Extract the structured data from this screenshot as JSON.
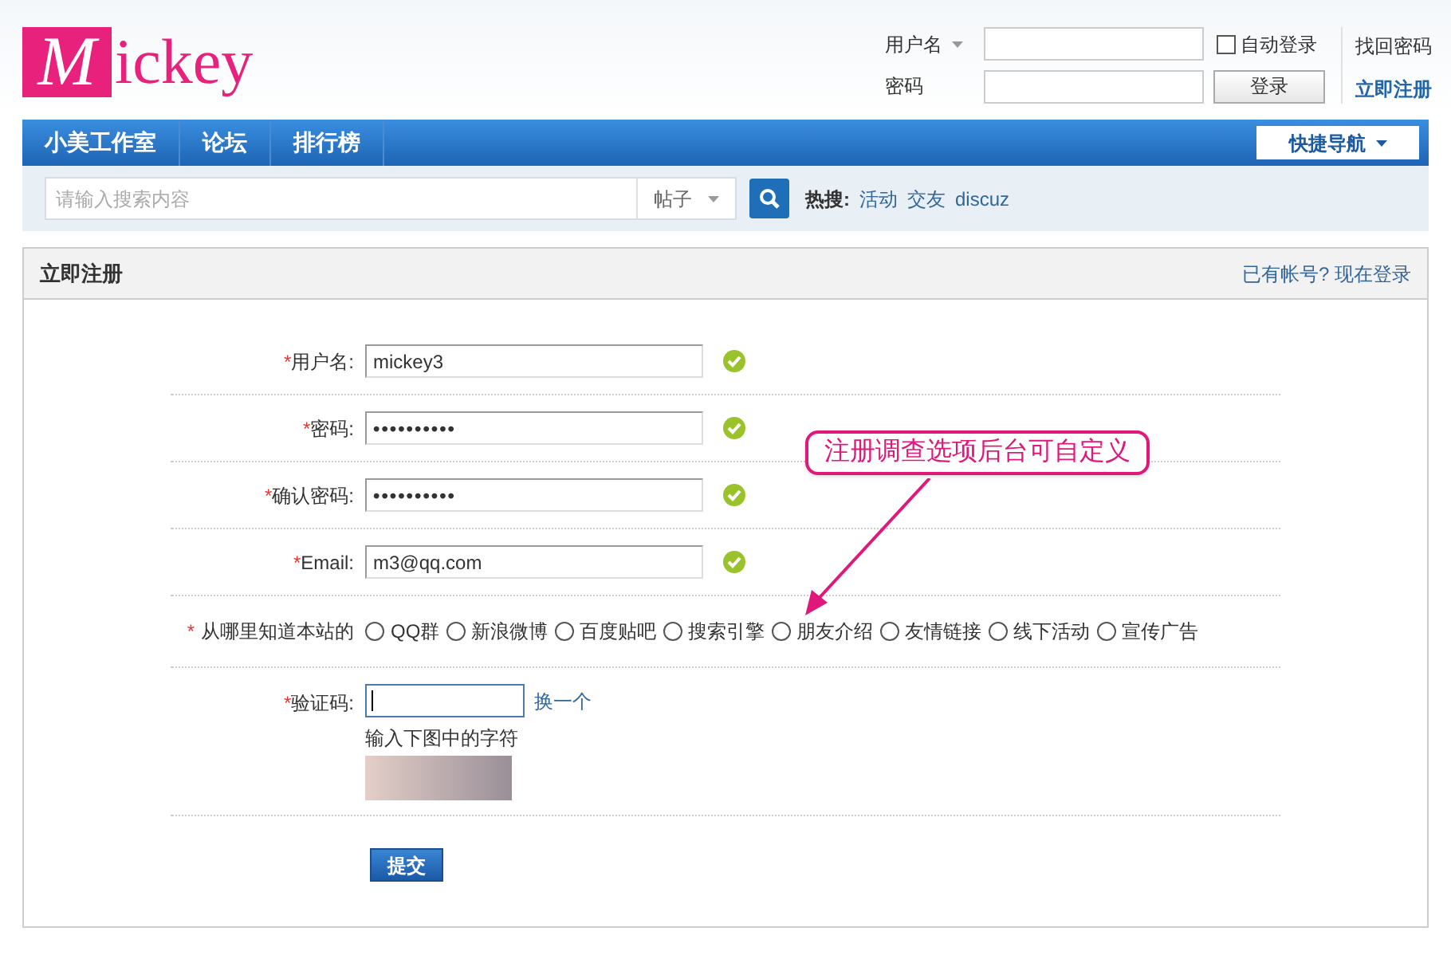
{
  "logo": {
    "initial": "M",
    "rest": "ickey"
  },
  "login": {
    "username_label": "用户名",
    "password_label": "密码",
    "auto_login": {
      "label": "自动登录",
      "checked": false
    },
    "login_button": "登录",
    "forgot_link": "找回密码",
    "register_link": "立即注册"
  },
  "nav": {
    "items": [
      {
        "label": "小美工作室"
      },
      {
        "label": "论坛"
      },
      {
        "label": "排行榜"
      }
    ],
    "quick_nav": "快捷导航"
  },
  "search": {
    "placeholder": "请输入搜索内容",
    "type": "帖子",
    "hot_label": "热搜:",
    "hot_links": [
      "活动",
      "交友",
      "discuz"
    ]
  },
  "panel": {
    "title": "立即注册",
    "login_link": "已有帐号? 现在登录",
    "fields": [
      {
        "label": "用户名:",
        "marker": "*",
        "value": "mickey3",
        "valid": true
      },
      {
        "label": "密码:",
        "marker": "*",
        "value": "••••••••••",
        "valid": true
      },
      {
        "label": "确认密码:",
        "marker": "*",
        "value": "••••••••••",
        "valid": true
      },
      {
        "label": "Email:",
        "marker": "*",
        "value": "m3@qq.com",
        "valid": true
      }
    ],
    "survey": {
      "label": "从哪里知道本站的",
      "marker": "*",
      "options": [
        {
          "label": "QQ群",
          "selected": false
        },
        {
          "label": "新浪微博",
          "selected": false
        },
        {
          "label": "百度贴吧",
          "selected": false
        },
        {
          "label": "搜索引擎",
          "selected": false
        },
        {
          "label": "朋友介绍",
          "selected": false
        },
        {
          "label": "友情链接",
          "selected": false
        },
        {
          "label": "线下活动",
          "selected": false
        },
        {
          "label": "宣传广告",
          "selected": false
        }
      ]
    },
    "captcha": {
      "label": "验证码:",
      "marker": "*",
      "refresh_link": "换一个",
      "hint": "输入下图中的字符"
    },
    "submit": "提交"
  },
  "callout": "注册调查选项后台可自定义"
}
